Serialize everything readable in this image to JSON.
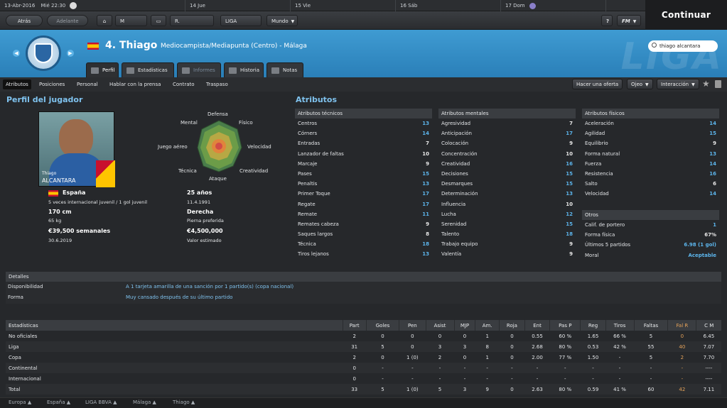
{
  "calendar": {
    "date": "13-Abr-2016",
    "day_time": "Mié 22:30",
    "days": [
      "14 Jue",
      "15 Vie",
      "16 Sáb",
      "17 Dom"
    ]
  },
  "continue_label": "Continuar",
  "nav": {
    "back": "Atrás",
    "forward": "Adelante",
    "manager": "M Salas",
    "club": "R. Sociedad",
    "league": "LIGA BBVA",
    "world": "Mundo",
    "help": "?",
    "fm": "FM"
  },
  "player": {
    "flag": "España",
    "title": "4. Thiago",
    "role": "Mediocampista/Mediapunta (Centro) - Málaga",
    "photo_name_small": "Thiago",
    "photo_name_big": "ALCANTARA"
  },
  "search": {
    "value": "thiago alcantara"
  },
  "tabs": [
    "Perfil",
    "Estadísticas",
    "Informes",
    "Historia",
    "Notas"
  ],
  "subnav": [
    "Atributos",
    "Posiciones",
    "Personal",
    "Hablar con la prensa",
    "Contrato",
    "Traspaso"
  ],
  "actions": [
    "Hacer una oferta",
    "Ojeo",
    "Interacción"
  ],
  "profile": {
    "heading": "Perfil del jugador",
    "radar_labels": [
      "Defensa",
      "Físico",
      "Velocidad",
      "Creatividad",
      "Ataque",
      "Técnica",
      "Juego aéreo",
      "Mental"
    ],
    "nationality": "España",
    "caps": "5 veces internacional juvenil / 1 gol juvenil",
    "age": "25 años",
    "dob": "11.4.1991",
    "height": "170 cm",
    "weight": "65 kg",
    "foot": "Derecha",
    "foot_label": "Pierna preferida",
    "wage": "€39,500 semanales",
    "contract_end": "30.6.2019",
    "value": "€4,500,000",
    "value_label": "Valor estimado"
  },
  "attributes": {
    "heading": "Atributos",
    "technical": {
      "title": "Atributos técnicos",
      "rows": [
        [
          "Centros",
          "13",
          true
        ],
        [
          "Córners",
          "14",
          true
        ],
        [
          "Entradas",
          "7",
          false
        ],
        [
          "Lanzador de faltas",
          "10",
          false
        ],
        [
          "Marcaje",
          "9",
          false
        ],
        [
          "Pases",
          "15",
          true
        ],
        [
          "Penaltis",
          "13",
          true
        ],
        [
          "Primer Toque",
          "17",
          true
        ],
        [
          "Regate",
          "17",
          true
        ],
        [
          "Remate",
          "11",
          true
        ],
        [
          "Remates cabeza",
          "9",
          false
        ],
        [
          "Saques largos",
          "8",
          false
        ],
        [
          "Técnica",
          "18",
          true
        ],
        [
          "Tiros lejanos",
          "13",
          true
        ]
      ]
    },
    "mental": {
      "title": "Atributos mentales",
      "rows": [
        [
          "Agresividad",
          "7",
          false
        ],
        [
          "Anticipación",
          "17",
          true
        ],
        [
          "Colocación",
          "9",
          false
        ],
        [
          "Concentración",
          "10",
          false
        ],
        [
          "Creatividad",
          "16",
          true
        ],
        [
          "Decisiones",
          "15",
          true
        ],
        [
          "Desmarques",
          "15",
          true
        ],
        [
          "Determinación",
          "13",
          true
        ],
        [
          "Influencia",
          "10",
          false
        ],
        [
          "Lucha",
          "12",
          true
        ],
        [
          "Serenidad",
          "15",
          true
        ],
        [
          "Talento",
          "18",
          true
        ],
        [
          "Trabajo equipo",
          "9",
          false
        ],
        [
          "Valentía",
          "9",
          false
        ]
      ]
    },
    "physical": {
      "title": "Atributos físicos",
      "rows": [
        [
          "Aceleración",
          "14",
          true
        ],
        [
          "Agilidad",
          "15",
          true
        ],
        [
          "Equilibrio",
          "9",
          false
        ],
        [
          "Forma natural",
          "13",
          true
        ],
        [
          "Fuerza",
          "14",
          true
        ],
        [
          "Resistencia",
          "16",
          true
        ],
        [
          "Salto",
          "6",
          false
        ],
        [
          "Velocidad",
          "14",
          true
        ]
      ]
    },
    "other": {
      "title": "Otros",
      "rows": [
        [
          "Calif. de portero",
          "1",
          true
        ],
        [
          "Forma física",
          "67%",
          false
        ],
        [
          "Últimos 5 partidos",
          "6.98 (1 gol)",
          true
        ],
        [
          "Moral",
          "Aceptable",
          true
        ]
      ]
    }
  },
  "details": {
    "title": "Detalles",
    "availability_label": "Disponibilidad",
    "availability": "A 1 tarjeta amarilla de una sanción por 1 partido(s) (copa nacional)",
    "form_label": "Forma",
    "form": "Muy cansado después de su último partido"
  },
  "stats": {
    "headers": [
      "Estadísticas",
      "Part",
      "Goles",
      "Pen",
      "Asist",
      "MJP",
      "Am.",
      "Roja",
      "Ent",
      "Pas P",
      "Reg",
      "Tiros",
      "Faltas",
      "Fal R",
      "C M"
    ],
    "rows": [
      [
        "No oficiales",
        "2",
        "0",
        "0",
        "0",
        "0",
        "1",
        "0",
        "0.55",
        "60 %",
        "1.65",
        "66 %",
        "5",
        "0",
        "6.45"
      ],
      [
        "Liga",
        "31",
        "5",
        "0",
        "3",
        "3",
        "8",
        "0",
        "2.68",
        "80 %",
        "0.53",
        "42 %",
        "55",
        "40",
        "7.07"
      ],
      [
        "Copa",
        "2",
        "0",
        "1 (0)",
        "2",
        "0",
        "1",
        "0",
        "2.00",
        "77 %",
        "1.50",
        "-",
        "5",
        "2",
        "7.70"
      ],
      [
        "Continental",
        "0",
        "-",
        "-",
        "-",
        "-",
        "-",
        "-",
        "-",
        "-",
        "-",
        "-",
        "-",
        "-",
        "----"
      ],
      [
        "Internacional",
        "0",
        "-",
        "-",
        "-",
        "-",
        "-",
        "-",
        "-",
        "-",
        "-",
        "-",
        "-",
        "-",
        "----"
      ],
      [
        "Total",
        "33",
        "5",
        "1 (0)",
        "5",
        "3",
        "9",
        "0",
        "2.63",
        "80 %",
        "0.59",
        "41 %",
        "60",
        "42",
        "7.11"
      ]
    ]
  },
  "breadcrumbs": [
    "Europa",
    "España",
    "LIGA BBVA",
    "Málaga",
    "Thiago"
  ],
  "colors": {
    "accent": "#7fc2ee",
    "header_blue": "#3a95cf",
    "value_blue": "#5cb5ec"
  }
}
